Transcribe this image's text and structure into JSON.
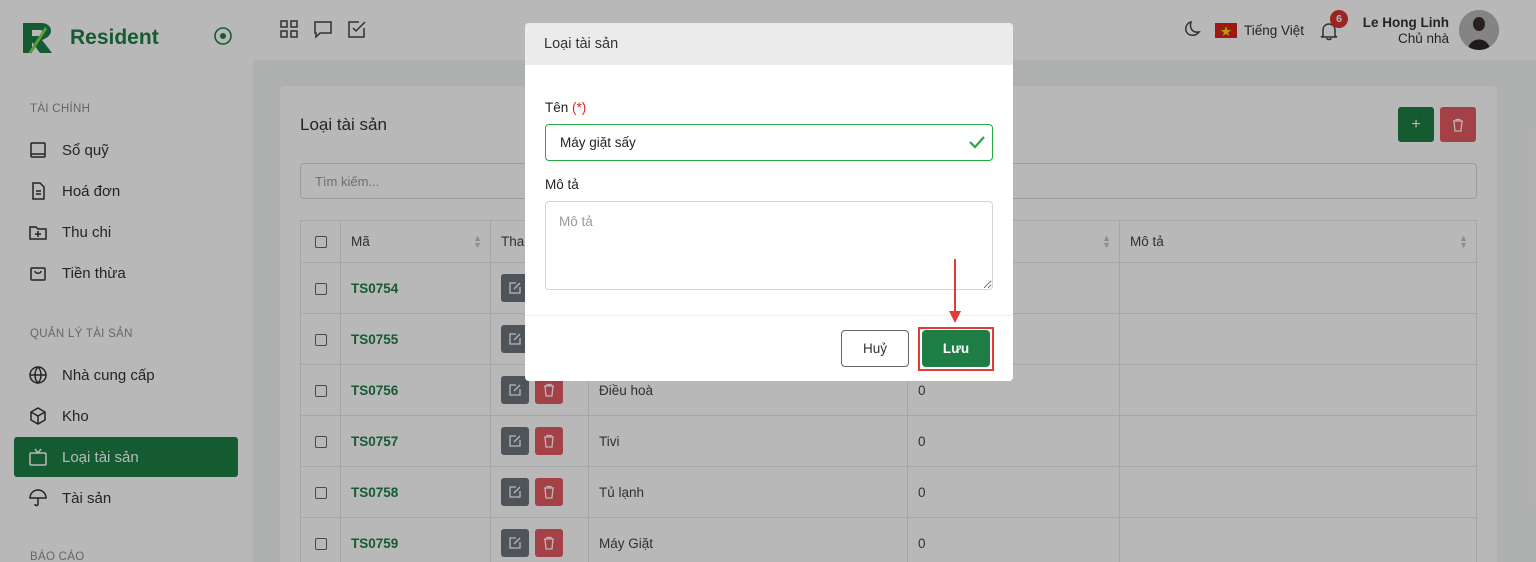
{
  "app": {
    "name": "Resident"
  },
  "sidebar": {
    "sections": [
      {
        "title": "TÀI CHÍNH",
        "items": [
          {
            "label": "Sổ quỹ",
            "icon": "book-icon"
          },
          {
            "label": "Hoá đơn",
            "icon": "invoice-icon"
          },
          {
            "label": "Thu chi",
            "icon": "folder-plus-icon"
          },
          {
            "label": "Tiền thừa",
            "icon": "bag-icon"
          }
        ]
      },
      {
        "title": "QUẢN LÝ TÀI SẢN",
        "items": [
          {
            "label": "Nhà cung cấp",
            "icon": "globe-icon"
          },
          {
            "label": "Kho",
            "icon": "box-icon"
          },
          {
            "label": "Loại tài sản",
            "icon": "tv-icon",
            "active": true
          },
          {
            "label": "Tài sản",
            "icon": "umbrella-icon"
          }
        ]
      },
      {
        "title": "BÁO CÁO",
        "items": []
      }
    ]
  },
  "topbar": {
    "language": "Tiếng Việt",
    "notification_count": "6",
    "user_name": "Le Hong Linh",
    "user_role": "Chủ nhà"
  },
  "page": {
    "title": "Loại tài sản",
    "add_label": "+",
    "search_placeholder": "Tìm kiếm...",
    "columns": [
      "Mã",
      "Tha",
      "",
      "Mô tả"
    ],
    "rows": [
      {
        "code": "TS0754",
        "name": "",
        "qty": ""
      },
      {
        "code": "TS0755",
        "name": "",
        "qty": ""
      },
      {
        "code": "TS0756",
        "name": "Điều hoà",
        "qty": "0"
      },
      {
        "code": "TS0757",
        "name": "Tivi",
        "qty": "0"
      },
      {
        "code": "TS0758",
        "name": "Tủ lạnh",
        "qty": "0"
      },
      {
        "code": "TS0759",
        "name": "Máy Giặt",
        "qty": "0"
      }
    ]
  },
  "modal": {
    "title": "Loại tài sản",
    "name_label": "Tên",
    "required_mark": "(*)",
    "name_value": "Máy giặt sấy",
    "desc_label": "Mô tả",
    "desc_placeholder": "Mô tả",
    "cancel_label": "Huỷ",
    "save_label": "Lưu"
  },
  "colors": {
    "brand": "#1e7e45",
    "danger": "#e25b63",
    "highlight": "#e53935"
  }
}
